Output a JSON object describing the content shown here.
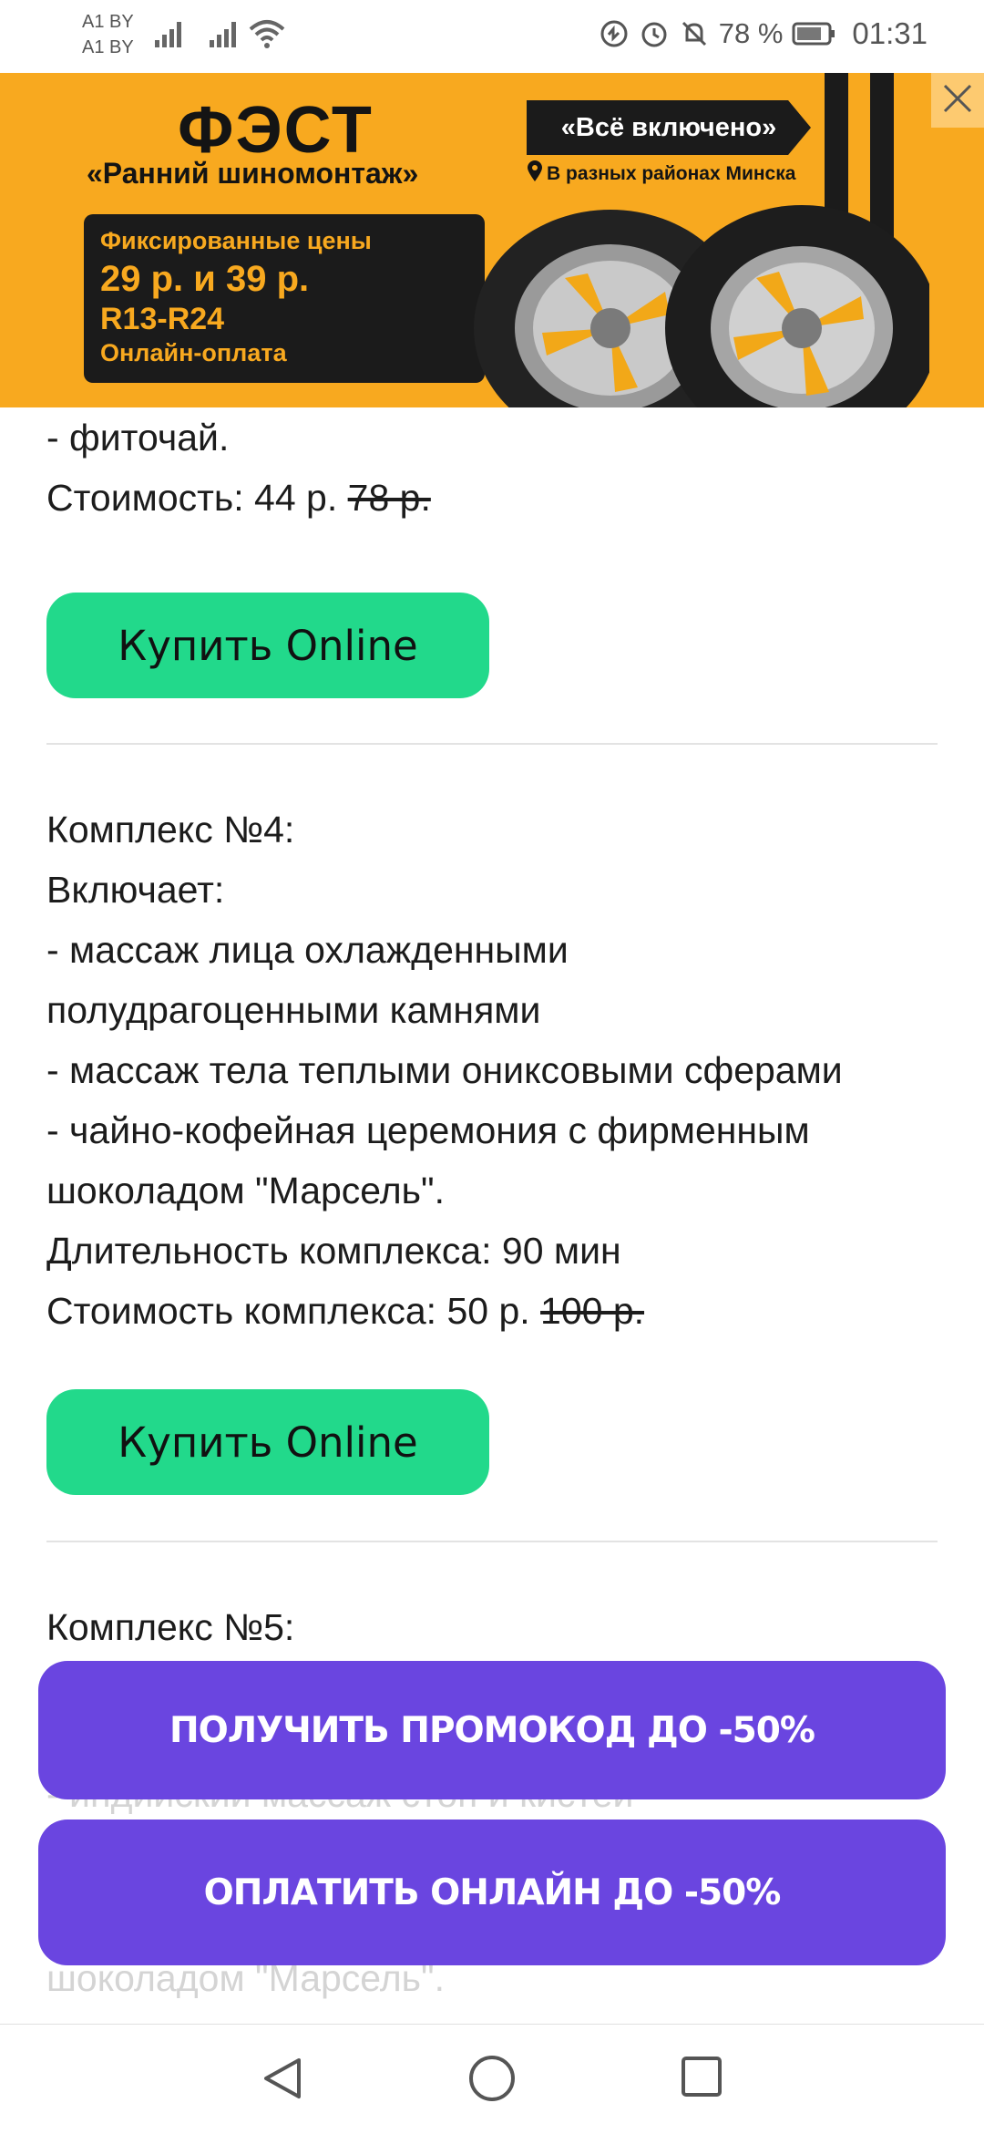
{
  "status_bar": {
    "carrier1": "A1 BY",
    "carrier2": "A1 BY",
    "battery": "78 %",
    "time": "01:31"
  },
  "banner": {
    "title": "ФЭСТ",
    "subtitle": "«Ранний шиномонтаж»",
    "pill": "«Всё включено»",
    "location": "В разных районах Минска",
    "price_line1": "Фиксированные цены",
    "price_line2": "29 р. и 39 р.",
    "price_line3": "R13-R24",
    "price_line4": "Онлайн-оплата",
    "colors": {
      "background": "#f8a91f",
      "dark": "#1b1b1b"
    }
  },
  "content": {
    "prev_item_tail": "- фиточай.",
    "prev_price_label": "Стоимость: 44 р.",
    "prev_price_old": "78 р.",
    "buy_label": "Купить Online",
    "complex4": {
      "title": "Комплекс №4:",
      "includes": "Включает:",
      "line1": "- массаж лица охлажденными",
      "line2": "полудрагоценными камнями",
      "line3": "- массаж тела теплыми ониксовыми сферами",
      "line4": "- чайно-кофейная церемония с фирменным",
      "line5": "шоколадом \"Марсель\".",
      "duration": "Длительность комплекса: 90 мин",
      "price_label": "Стоимость комплекса: 50 р.",
      "price_old": "100 р."
    },
    "complex5": {
      "title": "Комплекс №5:",
      "partial1": "- индийский массаж стоп и кистей",
      "partial2": "шоколадом \"Марсель\"."
    }
  },
  "cta": {
    "promo": "ПОЛУЧИТЬ ПРОМОКОД ДО -50%",
    "pay": "ОПЛАТИТЬ ОНЛАЙН ДО -50%",
    "color": "#6a45e0"
  },
  "accent": {
    "buy_button": "#22d98b"
  }
}
